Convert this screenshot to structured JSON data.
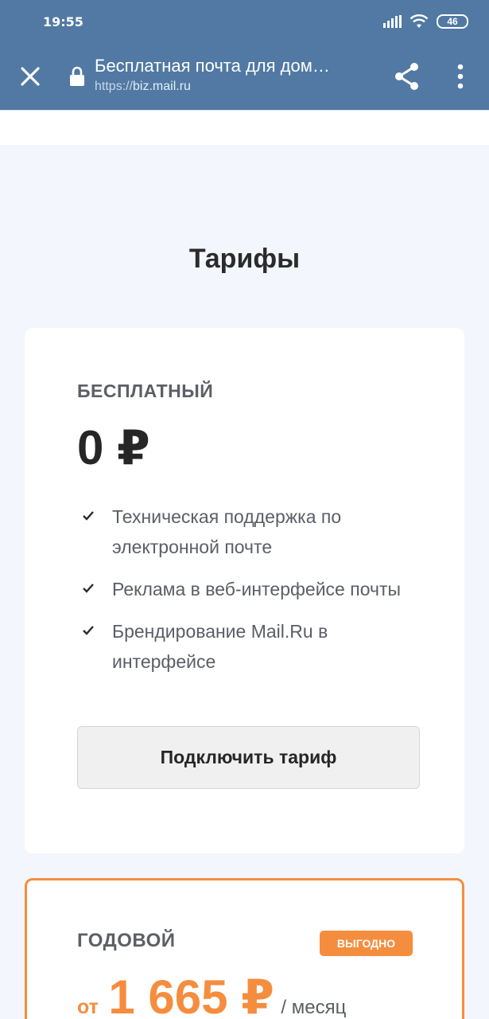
{
  "status_bar": {
    "time": "19:55",
    "battery": "46"
  },
  "browser": {
    "title": "Бесплатная почта для дом…",
    "url_scheme": "https://",
    "url_host": "biz.mail.ru"
  },
  "section": {
    "title": "Тарифы"
  },
  "plans": [
    {
      "name": "БЕСПЛАТНЫЙ",
      "price": "0 ₽",
      "features": [
        "Техническая поддержка по электронной почте",
        "Реклама в веб-интерфейсе почты",
        "Брендирование Mail.Ru в интерфейсе"
      ],
      "button_label": "Подключить тариф"
    },
    {
      "name": "ГОДОВОЙ",
      "badge": "ВЫГОДНО",
      "price_prefix": "от",
      "price": "1 665 ₽",
      "price_period": "/ месяц"
    }
  ],
  "colors": {
    "toolbar": "#5179a3",
    "accent": "#f58d3f",
    "page_bg": "#f3f6fc"
  },
  "icons": [
    "close-icon",
    "lock-icon",
    "share-icon",
    "more-vertical-icon",
    "check-icon",
    "wifi-icon",
    "signal-icon",
    "battery-icon"
  ]
}
